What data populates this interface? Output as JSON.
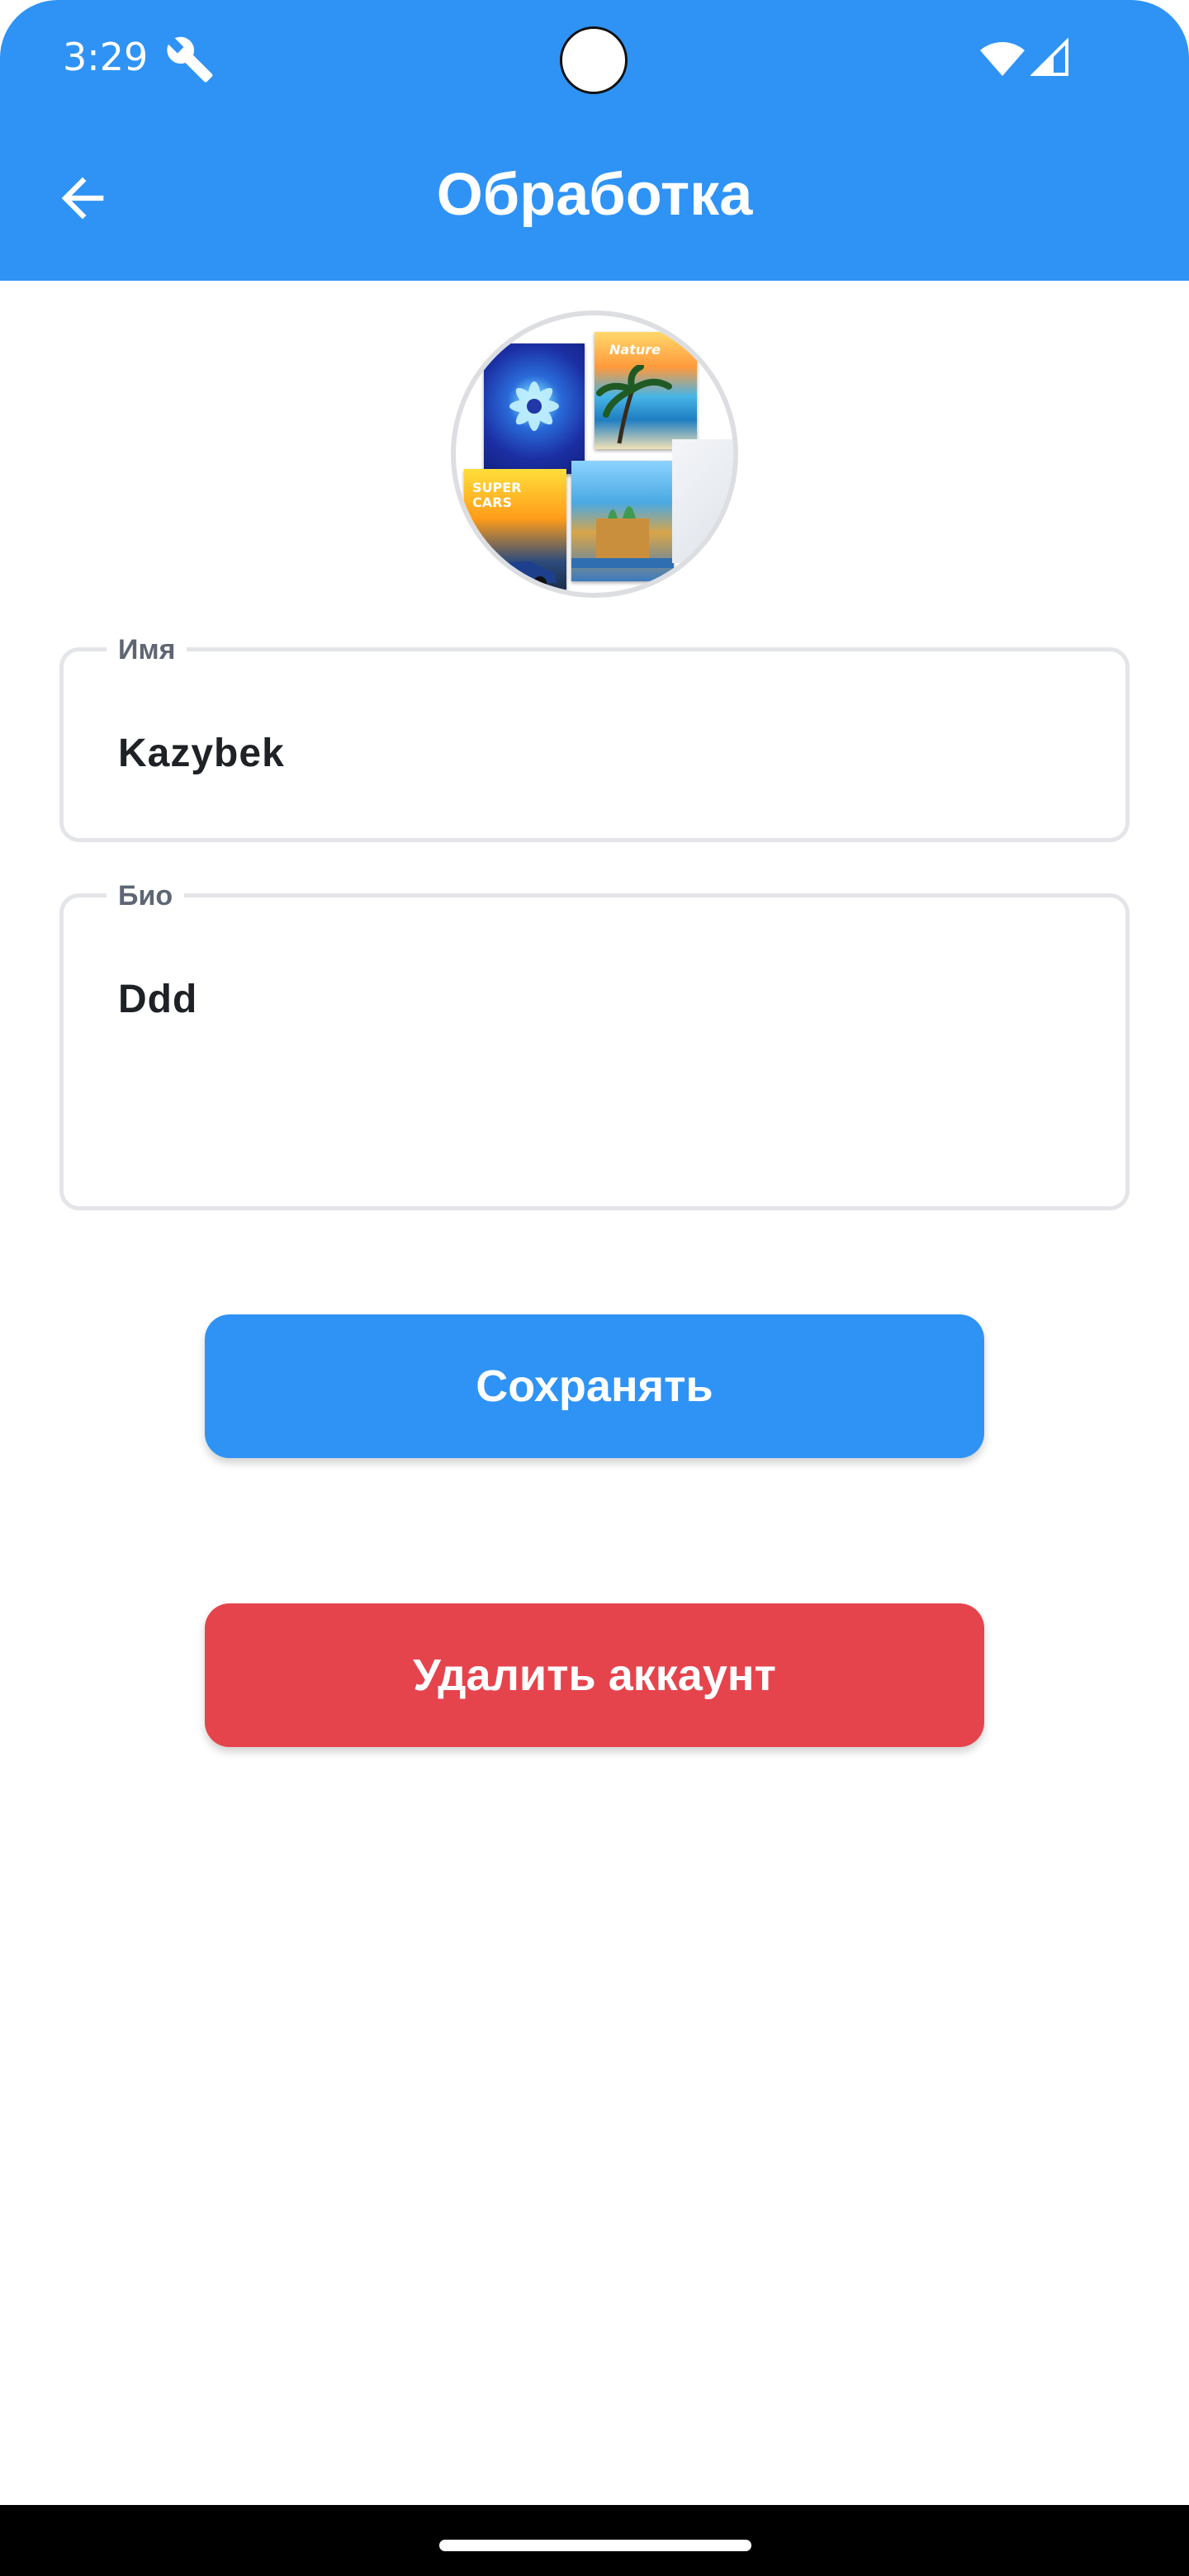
{
  "status_bar": {
    "time": "3:29",
    "icons": [
      "wrench-icon",
      "wifi-icon",
      "signal-icon"
    ]
  },
  "app_bar": {
    "title": "Обработка",
    "back_icon": "arrow-left-icon"
  },
  "avatar": {
    "thumbnails": [
      "flower",
      "nature",
      "cars",
      "city"
    ],
    "thumb_labels": {
      "nature": "Nature",
      "cars": "SUPER CARS"
    }
  },
  "form": {
    "name": {
      "label": "Имя",
      "value": "Kazybek"
    },
    "bio": {
      "label": "Био",
      "value": "Ddd"
    }
  },
  "buttons": {
    "save_label": "Сохранять",
    "delete_label": "Удалить аккаунт"
  },
  "colors": {
    "primary": "#2F93F5",
    "danger": "#E5444D",
    "field_border": "#E3E5E8",
    "label": "#5E6674",
    "text": "#1E2126"
  }
}
